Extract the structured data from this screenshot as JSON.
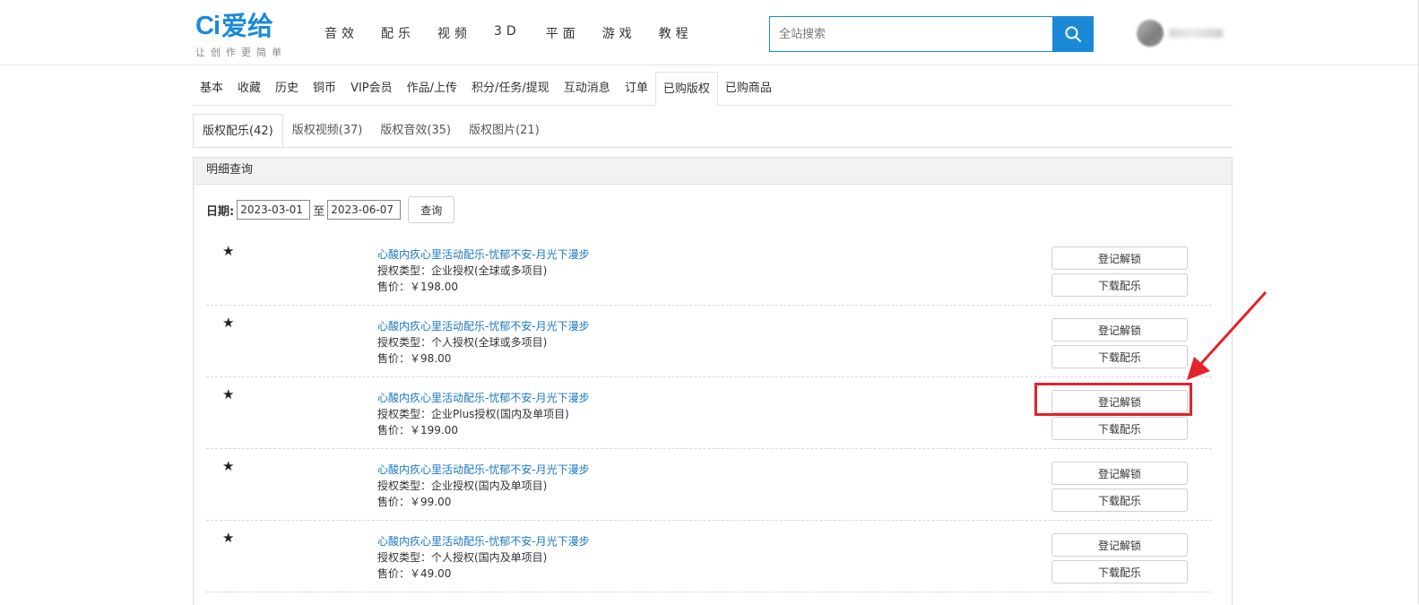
{
  "brand": {
    "logo_ci": "Ci",
    "logo_name": "爱给",
    "tagline": "让创作更简单",
    "accent_color": "#1a8ad8"
  },
  "nav": {
    "items": [
      "音效",
      "配乐",
      "视频",
      "3D",
      "平面",
      "游戏",
      "教程"
    ]
  },
  "search": {
    "placeholder": "全站搜索",
    "icon": "search-icon"
  },
  "account_tabs": {
    "items": [
      "基本",
      "收藏",
      "历史",
      "铜币",
      "VIP会员",
      "作品/上传",
      "积分/任务/提现",
      "互动消息",
      "订单",
      "已购版权",
      "已购商品"
    ],
    "active": "已购版权"
  },
  "copyright_tabs": {
    "items": [
      "版权配乐(42)",
      "版权视频(37)",
      "版权音效(35)",
      "版权图片(21)"
    ],
    "active": "版权配乐(42)"
  },
  "panel": {
    "title": "明细查询",
    "date_label": "日期:",
    "date_from": "2023-03-01",
    "to_text": "至",
    "date_to": "2023-06-07",
    "query_button": "查询"
  },
  "records": [
    {
      "star": "★",
      "title": "心酸内疚心里活动配乐-忧郁不安-月光下漫步",
      "license": "授权类型：企业授权(全球或多项目)",
      "price": "售价：￥198.00",
      "register_btn": "登记解锁",
      "download_btn": "下载配乐"
    },
    {
      "star": "★",
      "title": "心酸内疚心里活动配乐-忧郁不安-月光下漫步",
      "license": "授权类型：个人授权(全球或多项目)",
      "price": "售价：￥98.00",
      "register_btn": "登记解锁",
      "download_btn": "下载配乐"
    },
    {
      "star": "★",
      "title": "心酸内疚心里活动配乐-忧郁不安-月光下漫步",
      "license": "授权类型：企业Plus授权(国内及单项目)",
      "price": "售价：￥199.00",
      "register_btn": "登记解锁",
      "download_btn": "下载配乐"
    },
    {
      "star": "★",
      "title": "心酸内疚心里活动配乐-忧郁不安-月光下漫步",
      "license": "授权类型：企业授权(国内及单项目)",
      "price": "售价：￥99.00",
      "register_btn": "登记解锁",
      "download_btn": "下载配乐"
    },
    {
      "star": "★",
      "title": "心酸内疚心里活动配乐-忧郁不安-月光下漫步",
      "license": "授权类型：个人授权(国内及单项目)",
      "price": "售价：￥49.00",
      "register_btn": "登记解锁",
      "download_btn": "下载配乐"
    }
  ],
  "annotation": {
    "highlight_color": "#e3222a"
  }
}
